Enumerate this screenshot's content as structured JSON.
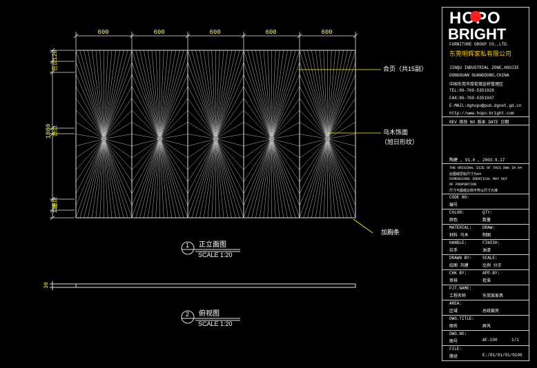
{
  "logo": {
    "top": "HOPO",
    "bottom": "BRIGHT"
  },
  "company": {
    "en": "FURNITURE GROUP CO.,LTD.",
    "cn": "东莞明辉家私有限公司",
    "addr_en1": "JINQU INDUSTRIAL ZONE,HOUJIE",
    "addr_en2": "DONGGUAN GUANGDONG,CHINA",
    "addr_cn": "中国东莞市厚街镇金桥管理区",
    "tel": "TEL:86-769-5351928",
    "fax": "FAX:86-769-5351947",
    "email": "E-MAIL:dghopo@pub.dgnet.gd.cn",
    "web": "http://www.hopo-bright.com"
  },
  "dims": {
    "top": [
      "600",
      "600",
      "600",
      "600",
      "600"
    ],
    "left_total": "1800",
    "left_top": "120",
    "left_bottom": "120",
    "left_small": "30"
  },
  "callouts": {
    "hinge": "合页（共15副）",
    "veneer1": "乌木饰面",
    "veneer2": "（旭日形纹）",
    "edge": "加胸条"
  },
  "left_labels": [
    "合页",
    "合页",
    "合页"
  ],
  "views": [
    {
      "num": "1",
      "title": "正立面图",
      "scale": "SCALE 1:20"
    },
    {
      "num": "2",
      "title": "俯视图",
      "scale": "SCALE 1:20"
    }
  ],
  "revision": {
    "header": "REV 修改  NO 版本  DATE 日期",
    "row": "陶建  , V1.0 , 2003.9.17"
  },
  "notes": [
    "THE ORIGINAL SIZE OF THIS DWG IN A4",
    "此图纸原始尺寸为A4",
    "DIMENSIONS IDENTICAL MAY OUT",
    "OF PROPORTION",
    "尺寸与图纸比例不符以尺寸为准"
  ],
  "fields": [
    {
      "en": "CODE NO:",
      "cn": "编号",
      "v1": "",
      "v2": ""
    },
    {
      "en": "COLOR:",
      "cn": "颜色",
      "v1": "QTY:",
      "v2": "数量"
    },
    {
      "en": "MATERIAL:",
      "cn": "材料  乌木",
      "v1": "DRAW:",
      "v2": "制图"
    },
    {
      "en": "HANDLE:",
      "cn": "拉手",
      "v1": "FINISH:",
      "v2": "油漆"
    },
    {
      "en": "DRAWN BY:",
      "cn": "绘图  刘建",
      "v1": "SCALE:",
      "v2": "比例  分示"
    },
    {
      "en": "CHK BY:",
      "cn": "审核",
      "v1": "APP.BY:",
      "v2": "批准"
    },
    {
      "en": "PJT.NAME:",
      "cn": "工程名称",
      "v1": "东莞某家具",
      "v2": ""
    },
    {
      "en": "AREA:",
      "cn": "区域",
      "v1": "总统套房",
      "v2": ""
    },
    {
      "en": "DWG.TITLE:",
      "cn": "图名",
      "v1": "屏风",
      "v2": ""
    },
    {
      "en": "DWG.NO:",
      "cn": "图号",
      "v1": "AF-100",
      "v2": "1/1"
    },
    {
      "en": "FILE:",
      "cn": "路径",
      "v1": "E:/01/01/01/0100",
      "v2": ""
    }
  ]
}
